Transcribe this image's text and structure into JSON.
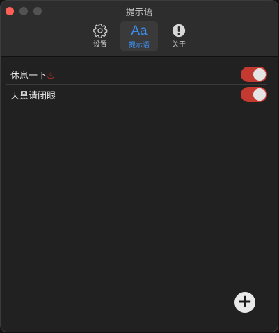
{
  "window": {
    "title": "提示语"
  },
  "toolbar": {
    "tabs": [
      {
        "label": "设置",
        "icon": "gear-icon"
      },
      {
        "label": "提示语",
        "icon": "text-aa-icon",
        "glyph": "Aa"
      },
      {
        "label": "关于",
        "icon": "info-exclamation-icon",
        "glyph": "!"
      }
    ],
    "selected": "提示语"
  },
  "prompts": [
    {
      "text": "休息一下",
      "emoji": "♨",
      "enabled": true
    },
    {
      "text": "天黑请闭眼",
      "emoji": "",
      "enabled": true
    }
  ],
  "add_button": {
    "glyph": "+"
  },
  "colors": {
    "accent": "#3b8ef0",
    "toggle_on": "#c43a30",
    "close": "#ff5f57"
  }
}
